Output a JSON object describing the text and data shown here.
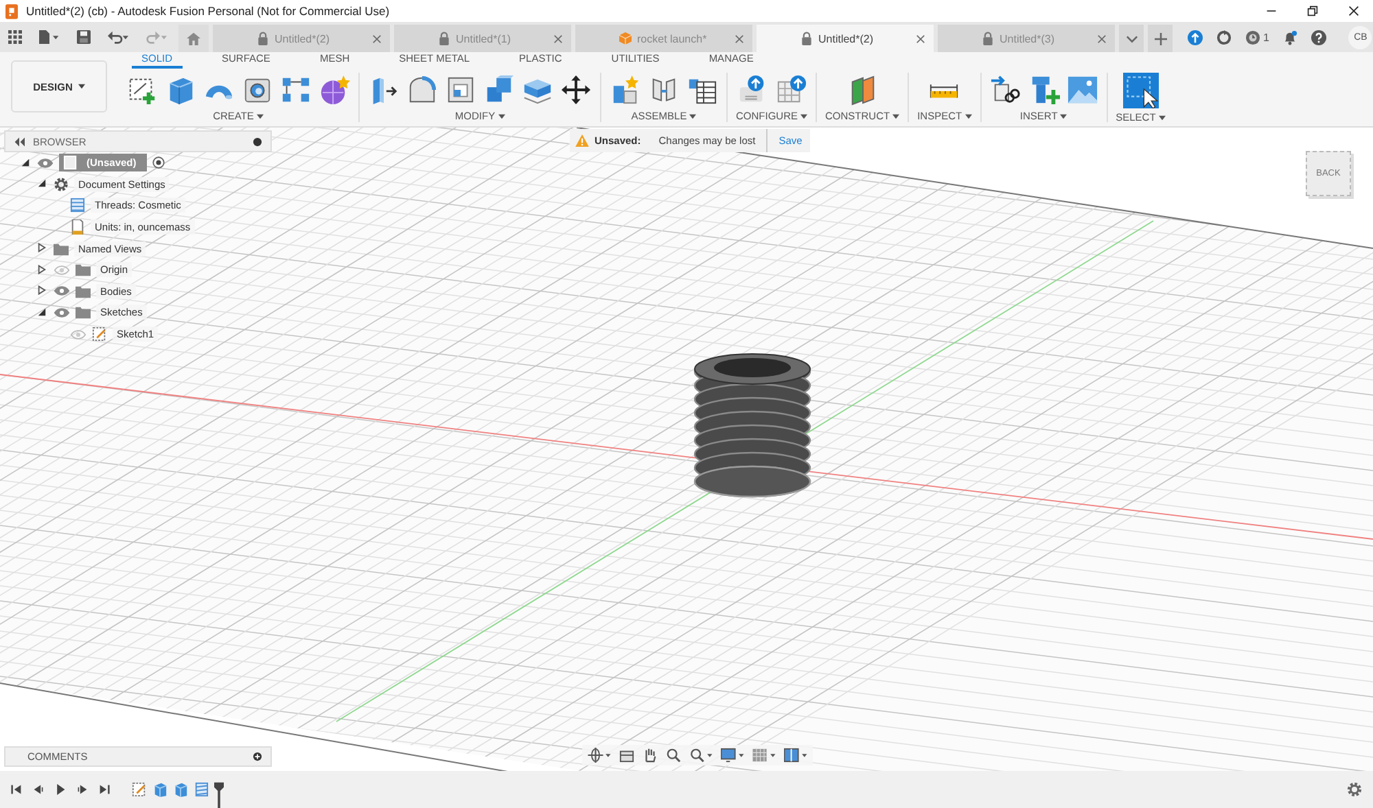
{
  "window": {
    "title": "Untitled*(2) (cb) - Autodesk Fusion Personal (Not for Commercial Use)"
  },
  "doc_tabs": [
    {
      "label": "Untitled*(2)",
      "kind": "locked",
      "selected": false
    },
    {
      "label": "Untitled*(1)",
      "kind": "locked",
      "selected": false
    },
    {
      "label": "rocket launch*",
      "kind": "model",
      "selected": false
    },
    {
      "label": "Untitled*(2)",
      "kind": "locked",
      "selected": true
    },
    {
      "label": "Untitled*(3)",
      "kind": "locked",
      "selected": false
    }
  ],
  "jobs_count": "1",
  "user_initials": "CB",
  "workspace": "DESIGN",
  "ribbon_tabs": [
    {
      "label": "SOLID",
      "selected": true
    },
    {
      "label": "SURFACE",
      "selected": false
    },
    {
      "label": "MESH",
      "selected": false
    },
    {
      "label": "SHEET METAL",
      "selected": false
    },
    {
      "label": "PLASTIC",
      "selected": false
    },
    {
      "label": "UTILITIES",
      "selected": false
    },
    {
      "label": "MANAGE",
      "selected": false
    }
  ],
  "tool_groups": [
    {
      "label": "CREATE"
    },
    {
      "label": "MODIFY"
    },
    {
      "label": "ASSEMBLE"
    },
    {
      "label": "CONFIGURE"
    },
    {
      "label": "CONSTRUCT"
    },
    {
      "label": "INSPECT"
    },
    {
      "label": "INSERT"
    },
    {
      "label": "SELECT"
    }
  ],
  "browser": {
    "title": "BROWSER",
    "tree": [
      {
        "label": "(Unsaved)",
        "kind": "root",
        "expanded": true,
        "visible": true,
        "children": [
          {
            "label": "Document Settings",
            "kind": "settings",
            "expanded": true,
            "children": [
              {
                "label": "Threads: Cosmetic",
                "kind": "thread"
              },
              {
                "label": "Units: in, ouncemass",
                "kind": "units"
              }
            ]
          },
          {
            "label": "Named Views",
            "kind": "folder",
            "expanded": false
          },
          {
            "label": "Origin",
            "kind": "folder",
            "expanded": false,
            "visible": false
          },
          {
            "label": "Bodies",
            "kind": "folder",
            "expanded": false,
            "visible": true
          },
          {
            "label": "Sketches",
            "kind": "folder",
            "expanded": true,
            "visible": true,
            "children": [
              {
                "label": "Sketch1",
                "kind": "sketch",
                "visible": false
              }
            ]
          }
        ]
      }
    ]
  },
  "banner": {
    "label": "Unsaved:",
    "message": "Changes may be lost",
    "action": "Save"
  },
  "view_cube": {
    "face": "BACK"
  },
  "comments": {
    "title": "COMMENTS"
  },
  "timeline": [
    {
      "kind": "sketch"
    },
    {
      "kind": "extrude"
    },
    {
      "kind": "extrude"
    },
    {
      "kind": "thread"
    }
  ]
}
